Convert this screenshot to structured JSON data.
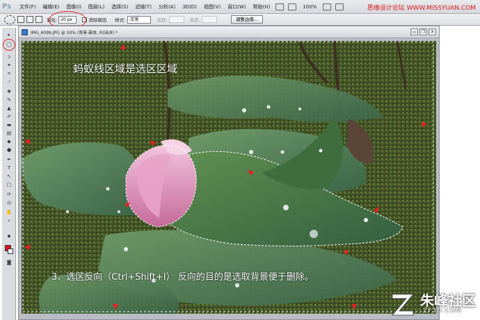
{
  "app": {
    "logo": "Ps",
    "zoom": "100%"
  },
  "menu": {
    "items": [
      "文件(F)",
      "编辑(E)",
      "图像(I)",
      "图层(L)",
      "选择(S)",
      "滤镜(T)",
      "分析(A)",
      "3D(D)",
      "视图(V)",
      "窗口(W)",
      "帮助(H)"
    ]
  },
  "watermark": "思缘设计论坛  WWW.MISSYUAN.COM",
  "options": {
    "feather_label": "羽化:",
    "feather_value": "20 px",
    "antialias_label": "消除锯齿",
    "style_label": "样式:",
    "style_value": "正常",
    "width_label": "宽度:",
    "height_label": "高度:",
    "refine_edge_button": "调整边缘..."
  },
  "document": {
    "title": "IMG_6099.JPG @ 50% (背景 副本, RGB/8) *",
    "minimize_glyph": "▭",
    "restore_glyph": "❐",
    "close_glyph": "✕"
  },
  "captions": {
    "top": "蚂蚁线区域是选区区域",
    "bottom": "3、选区反向（Ctrl+Shift+I） 反向的目的是选取背景便于删除。"
  },
  "brand": {
    "name": "朱峰社区",
    "url": "ZF3D.COM"
  },
  "colors": {
    "accent_red": "#e52222",
    "foreground_swatch": "#e10f1f"
  },
  "icons": [
    "marquee-tool-icon",
    "move-tool-icon",
    "lasso-tool-icon",
    "magic-wand-icon",
    "crop-icon",
    "eyedropper-icon",
    "brush-icon",
    "stamp-icon",
    "eraser-icon",
    "gradient-icon",
    "dodge-icon",
    "pen-icon",
    "type-icon",
    "path-select-icon",
    "shape-icon",
    "hand-icon",
    "zoom-icon"
  ]
}
